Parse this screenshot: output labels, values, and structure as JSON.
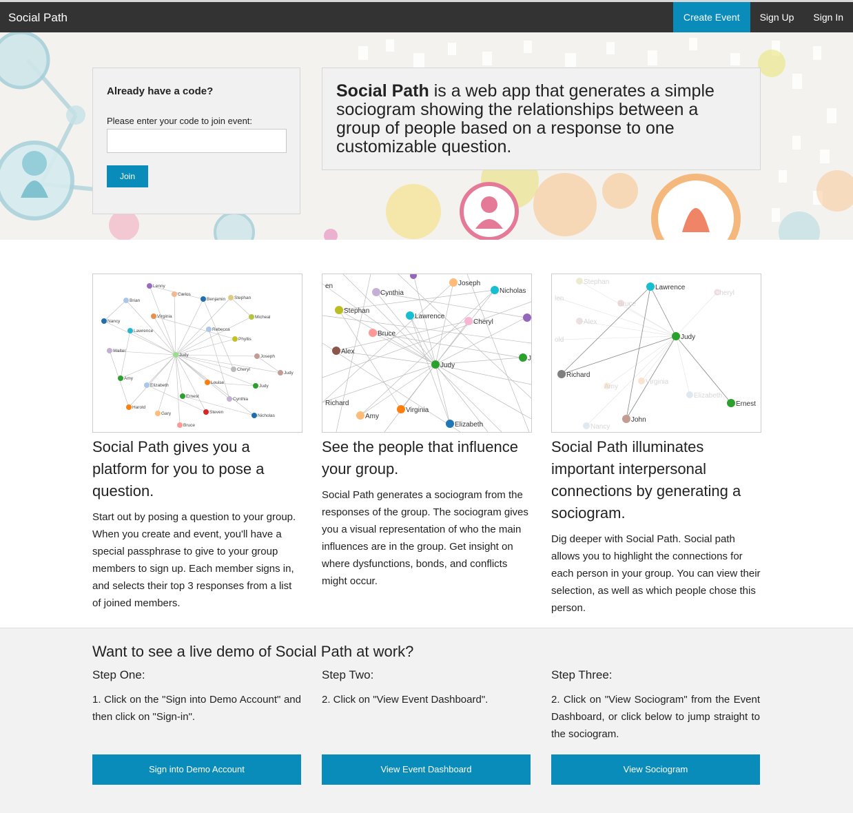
{
  "navbar": {
    "brand": "Social Path",
    "create_event": "Create Event",
    "sign_up": "Sign Up",
    "sign_in": "Sign In"
  },
  "join_panel": {
    "heading": "Already have a code?",
    "label": "Please enter your code to join event:",
    "input_value": "",
    "join_button": "Join"
  },
  "intro": {
    "brand": "Social Path",
    "text": " is a web app that generates a simple sociogram showing the relationships between a group of people based on a response to one customizable question."
  },
  "features": [
    {
      "title": "Social Path gives you a platform for you to pose a question.",
      "body": "Start out by posing a question to your group. When you create and event, you'll have a special passphrase to give to your group members to sign up. Each member signs in, and selects their top 3 responses from a list of joined members.",
      "graph": {
        "nodes": [
          "Lenny",
          "Carlos",
          "Brian",
          "Benjamin",
          "Stephan",
          "Virginia",
          "Micheal",
          "Nancy",
          "Rebecca",
          "Lawrence",
          "Phyllis",
          "Walter",
          "Judy",
          "Joseph",
          "Cheryl",
          "Judy",
          "Amy",
          "Elizabeth",
          "Louise",
          "Judy",
          "Ernest",
          "Cynthia",
          "Harold",
          "Gary",
          "Steven",
          "Nicholas",
          "Bruce"
        ]
      }
    },
    {
      "title": "See the people that influence your group.",
      "body": "Social Path generates a sociogram from the responses of the group. The sociogram gives you a visual representation of who the main influences are in the group. Get insight on where dysfunctions, bonds, and conflicts might occur.",
      "graph": {
        "nodes": [
          "en",
          "Cynthia",
          "Joseph",
          "Nicholas",
          "Stephan",
          "Lawrence",
          "Cheryl",
          "Bruce",
          "Alex",
          "Judy",
          "Richard",
          "Virginia",
          "Amy",
          "Elizabeth"
        ]
      }
    },
    {
      "title": "Social Path illuminates important interpersonal connections by generating a sociogram.",
      "body": "Dig deeper with Social Path. Social path allows you to highlight the connections for each person in your group. You can view their selection, as well as which people chose this person.",
      "graph": {
        "nodes": [
          "Lawrence",
          "Judy",
          "Richard",
          "Ernest",
          "John",
          "Stephan",
          "Bruce",
          "Cheryl",
          "Alex",
          "Virginia",
          "Amy",
          "Elizabeth",
          "Nancy"
        ]
      }
    }
  ],
  "demo": {
    "heading": "Want to see a live demo of Social Path at work?",
    "steps": [
      {
        "title": "Step One:",
        "text": "1. Click on the \"Sign into Demo Account\" and then click on \"Sign-in\".",
        "button": "Sign into Demo Account"
      },
      {
        "title": "Step Two:",
        "text": "2. Click on \"View Event Dashboard\".",
        "button": "View Event Dashboard"
      },
      {
        "title": "Step Three:",
        "text": "2. Click on \"View Sociogram\" from the Event Dashboard, or click below to jump straight to the sociogram.",
        "button": "View Sociogram"
      }
    ]
  },
  "colors": {
    "navbar": "#333333",
    "accent": "#0a8cbb"
  }
}
